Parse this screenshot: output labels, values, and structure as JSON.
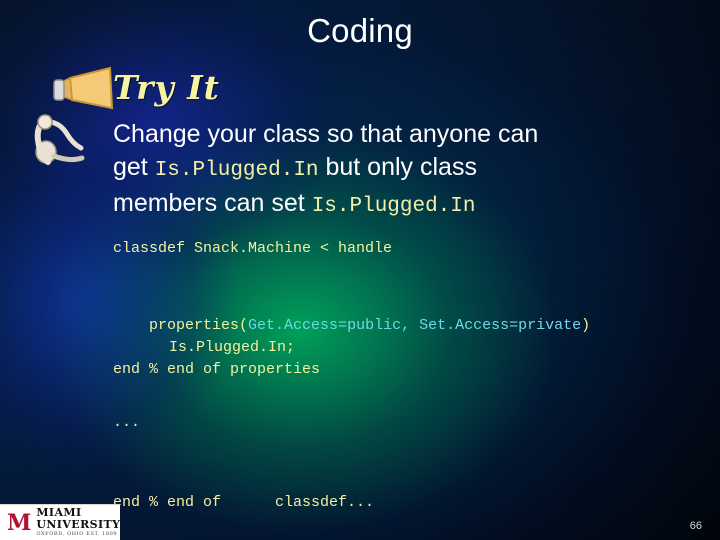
{
  "slide": {
    "title": "Coding",
    "section_heading": "Try It",
    "body": {
      "line1_a": "Change your class so that anyone can",
      "line2_a": "get ",
      "line2_code": "Is.Plugged.In",
      "line2_b": " but only class",
      "line3_a": "members can set ",
      "line3_code": "Is.Plugged.In"
    },
    "code": {
      "line1": "classdef Snack.Machine < handle",
      "line2_prefix": "properties(",
      "line2_get": "Get.Access=public,",
      "line2_set": " Set.Access=private",
      "line2_suffix": ")",
      "line2_indent": "Is.Plugged.In;",
      "line3": "end % end of properties",
      "line4": "...",
      "line5": "end % end of      classdef..."
    },
    "footer": {
      "logo_letter": "M",
      "logo_name": "MIAMI UNIVERSITY",
      "logo_sub": "OXFORD, OHIO  EST. 1809",
      "page_number": "66"
    },
    "colors": {
      "title_text": "#ffffff",
      "heading_text": "#f7f4a0",
      "code_text": "#f4f19f",
      "code_accent": "#6fd8e8",
      "background_green": "#00b45a",
      "background_blue": "#05204a",
      "logo_red": "#b2122f"
    }
  }
}
